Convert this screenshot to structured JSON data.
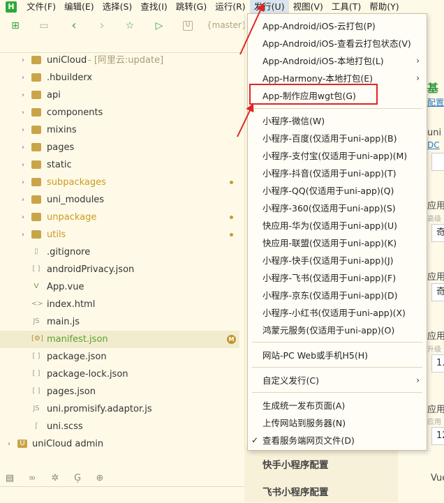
{
  "menubar": {
    "logo": "H",
    "items": [
      {
        "label": "文件(F)"
      },
      {
        "label": "编辑(E)"
      },
      {
        "label": "选择(S)"
      },
      {
        "label": "查找(I)"
      },
      {
        "label": "跳转(G)"
      },
      {
        "label": "运行(R)"
      },
      {
        "label": "发行(U)"
      },
      {
        "label": "视图(V)"
      },
      {
        "label": "工具(T)"
      },
      {
        "label": "帮助(Y)"
      }
    ]
  },
  "toolbar": {
    "branch_icon": "U",
    "branch": "{master}"
  },
  "tree": {
    "rows": [
      {
        "label": "uniCloud",
        "suffix": "- [阿里云:update]"
      },
      {
        "label": ".hbuilderx"
      },
      {
        "label": "api"
      },
      {
        "label": "components"
      },
      {
        "label": "mixins"
      },
      {
        "label": "pages"
      },
      {
        "label": "static"
      },
      {
        "label": "subpackages"
      },
      {
        "label": "uni_modules"
      },
      {
        "label": "unpackage"
      },
      {
        "label": "utils"
      },
      {
        "label": ".gitignore"
      },
      {
        "label": "androidPrivacy.json"
      },
      {
        "label": "App.vue"
      },
      {
        "label": "index.html"
      },
      {
        "label": "main.js"
      },
      {
        "label": "manifest.json",
        "badge": "M"
      },
      {
        "label": "package.json"
      },
      {
        "label": "package-lock.json"
      },
      {
        "label": "pages.json"
      },
      {
        "label": "uni.promisify.adaptor.js"
      },
      {
        "label": "uni.scss"
      },
      {
        "label": "uniCloud admin"
      }
    ]
  },
  "dropdown": {
    "items": [
      {
        "label": "App-Android/iOS-云打包(P)"
      },
      {
        "label": "App-Android/iOS-查看云打包状态(V)"
      },
      {
        "label": "App-Android/iOS-本地打包(L)"
      },
      {
        "label": "App-Harmony-本地打包(E)"
      },
      {
        "label": "App-制作应用wgt包(G)"
      },
      {
        "label": "小程序-微信(W)"
      },
      {
        "label": "小程序-百度(仅适用于uni-app)(B)"
      },
      {
        "label": "小程序-支付宝(仅适用于uni-app)(M)"
      },
      {
        "label": "小程序-抖音(仅适用于uni-app)(T)"
      },
      {
        "label": "小程序-QQ(仅适用于uni-app)(Q)"
      },
      {
        "label": "小程序-360(仅适用于uni-app)(S)"
      },
      {
        "label": "快应用-华为(仅适用于uni-app)(U)"
      },
      {
        "label": "快应用-联盟(仅适用于uni-app)(K)"
      },
      {
        "label": "小程序-快手(仅适用于uni-app)(J)"
      },
      {
        "label": "小程序-飞书(仅适用于uni-app)(F)"
      },
      {
        "label": "小程序-京东(仅适用于uni-app)(D)"
      },
      {
        "label": "小程序-小红书(仅适用于uni-app)(X)"
      },
      {
        "label": "鸿蒙元服务(仅适用于uni-app)(O)"
      },
      {
        "label": "网站-PC Web或手机H5(H)"
      },
      {
        "label": "自定义发行(C)"
      },
      {
        "label": "生成统一发布页面(A)"
      },
      {
        "label": "上传网站到服务器(N)"
      },
      {
        "label": "查看服务端网页文件(D)",
        "check": "✓"
      }
    ]
  },
  "editor": {
    "heading": "基",
    "link": "配置",
    "uni_label": "uni",
    "dc_link": "DC",
    "field1_label": "应用",
    "field1_hint": "高级",
    "field1_value": "奇",
    "field2_label": "应用",
    "field2_value": "奇",
    "field3_label": "应用",
    "field3_hint": "升级",
    "field3_value": "1.",
    "field4_label": "应用",
    "field4_hint": "应用",
    "field4_value": "12",
    "vue_label": "Vue",
    "cfg_douyin": "快手小程序配置",
    "cfg_feishu": "飞书小程序配置"
  }
}
